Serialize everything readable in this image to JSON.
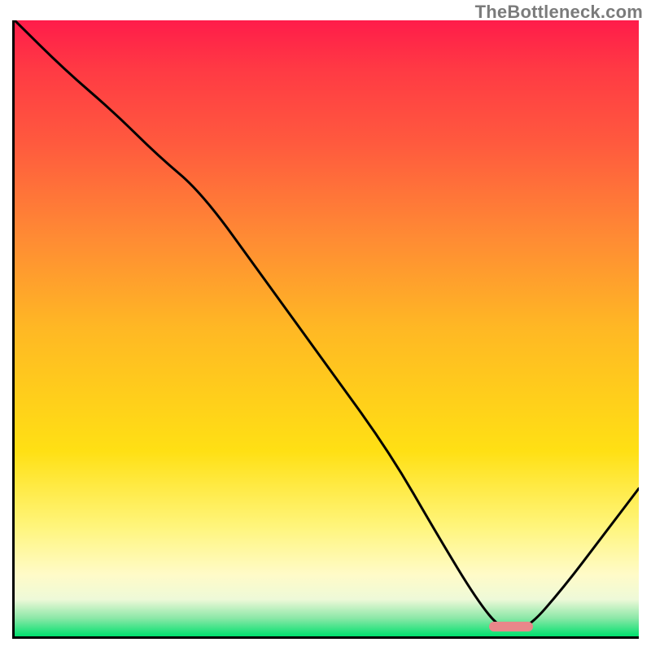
{
  "watermark": "TheBottleneck.com",
  "chart_data": {
    "type": "line",
    "title": "",
    "xlabel": "",
    "ylabel": "",
    "xlim": [
      0,
      100
    ],
    "ylim": [
      0,
      100
    ],
    "grid": false,
    "legend": false,
    "background_gradient": {
      "stops": [
        {
          "pos": 0,
          "color": "#ff1c4a"
        },
        {
          "pos": 8,
          "color": "#ff3a44"
        },
        {
          "pos": 20,
          "color": "#ff5a3e"
        },
        {
          "pos": 35,
          "color": "#ff8a34"
        },
        {
          "pos": 50,
          "color": "#ffb824"
        },
        {
          "pos": 70,
          "color": "#ffe014"
        },
        {
          "pos": 82,
          "color": "#fff57a"
        },
        {
          "pos": 90,
          "color": "#fffbc8"
        },
        {
          "pos": 94,
          "color": "#eef9d8"
        },
        {
          "pos": 97,
          "color": "#8de8a8"
        },
        {
          "pos": 100,
          "color": "#00e06e"
        }
      ]
    },
    "series": [
      {
        "name": "bottleneck-curve",
        "x": [
          0,
          8,
          16,
          23,
          30,
          40,
          50,
          60,
          68,
          74,
          78,
          82,
          88,
          94,
          100
        ],
        "y": [
          100,
          92,
          85,
          78,
          72,
          58,
          44,
          30,
          16,
          6,
          1,
          1,
          8,
          16,
          24
        ]
      }
    ],
    "annotations": [
      {
        "type": "marker",
        "shape": "rounded-rect",
        "color": "#e9878a",
        "x_range": [
          76,
          83
        ],
        "y": 1
      }
    ]
  }
}
